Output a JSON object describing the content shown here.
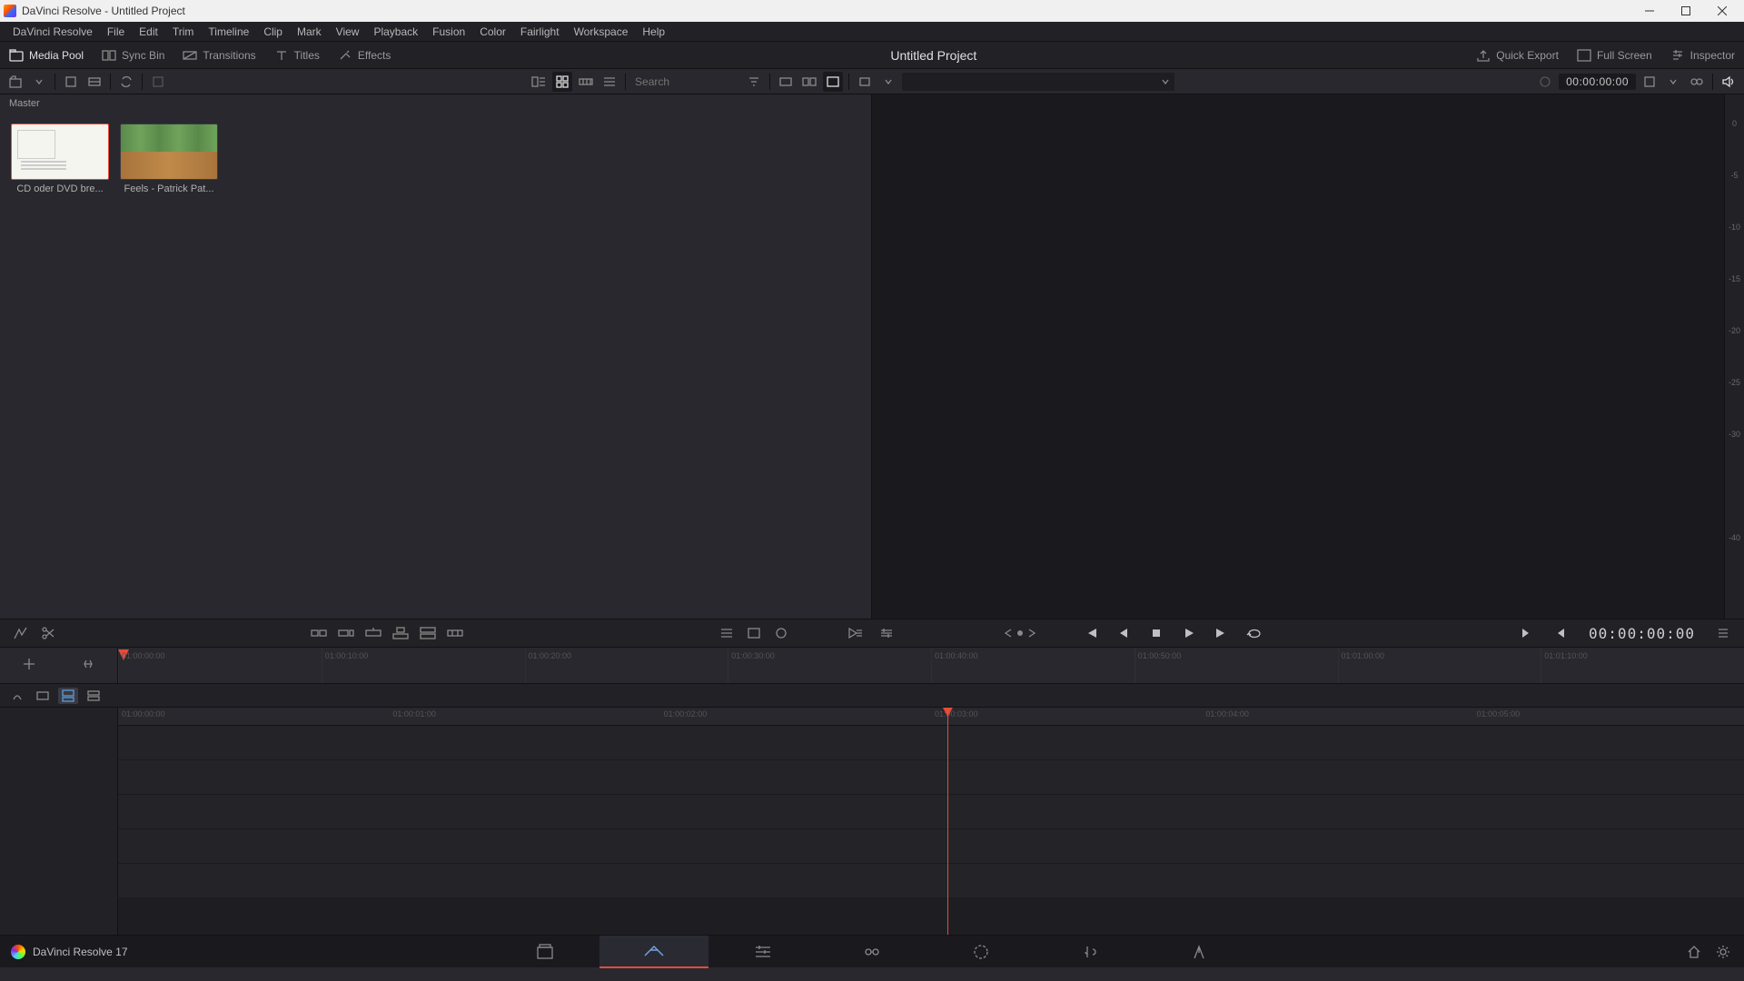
{
  "window": {
    "title": "DaVinci Resolve - Untitled Project"
  },
  "menu": {
    "items": [
      "DaVinci Resolve",
      "File",
      "Edit",
      "Trim",
      "Timeline",
      "Clip",
      "Mark",
      "View",
      "Playback",
      "Fusion",
      "Color",
      "Fairlight",
      "Workspace",
      "Help"
    ]
  },
  "panels": {
    "mediaPool": "Media Pool",
    "syncBin": "Sync Bin",
    "transitions": "Transitions",
    "titles": "Titles",
    "effects": "Effects",
    "projectTitle": "Untitled Project",
    "quickExport": "Quick Export",
    "fullScreen": "Full Screen",
    "inspector": "Inspector"
  },
  "toolbar": {
    "searchPlaceholder": "Search",
    "timecode1": "00:00:00:00"
  },
  "mediaPool": {
    "breadcrumb": "Master",
    "clips": [
      {
        "label": "CD oder DVD bre...",
        "kind": "image",
        "selected": true
      },
      {
        "label": "Feels - Patrick Pat...",
        "kind": "audio",
        "selected": false
      }
    ]
  },
  "audioMeter": {
    "ticks": [
      "0",
      "-5",
      "-10",
      "-15",
      "-20",
      "-25",
      "-30",
      "",
      "-40",
      ""
    ]
  },
  "rulerMini": {
    "ticks": [
      "01:00:00:00",
      "01:00:10:00",
      "01:00:20:00",
      "01:00:30:00",
      "01:00:40:00",
      "01:00:50:00",
      "01:01:00:00",
      "01:01:10:00"
    ]
  },
  "ruler2": {
    "ticks": [
      "01:00:00:00",
      "01:00:01:00",
      "01:00:02:00",
      "01:00:03:00",
      "01:00:04:00",
      "01:00:05:00"
    ]
  },
  "transport": {
    "tc": "00:00:00:00"
  },
  "bottom": {
    "appName": "DaVinci Resolve 17",
    "pages": [
      "Media",
      "Cut",
      "Edit",
      "Fusion",
      "Color",
      "Fairlight",
      "Deliver"
    ],
    "activePage": 1
  }
}
